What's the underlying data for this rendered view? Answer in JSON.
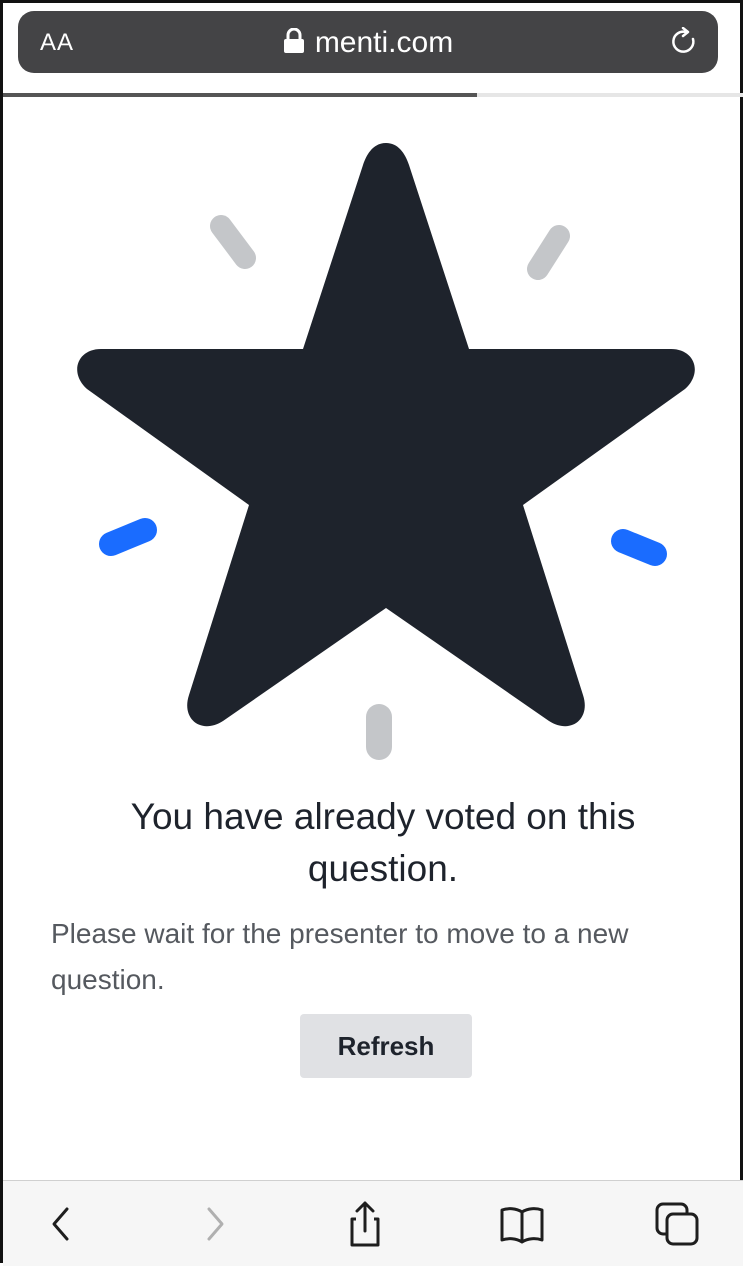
{
  "browser": {
    "text_size_label": "AA",
    "url": "menti.com",
    "page_load_progress": 0.64
  },
  "page": {
    "headline": "You have already voted on this question.",
    "subtext": "Please wait for the presenter to move to a new question.",
    "refresh_label": "Refresh"
  },
  "illustration": {
    "star_color": "#1e232c",
    "accent_blue": "#1a6cff",
    "accent_gray": "#c4c6c9"
  },
  "toolbar": {
    "items": [
      "back-icon",
      "forward-icon",
      "share-icon",
      "bookmarks-icon",
      "tabs-icon"
    ]
  }
}
